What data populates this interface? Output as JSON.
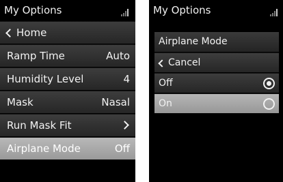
{
  "left_screen": {
    "title": "My Options",
    "items": [
      {
        "label": "Home"
      },
      {
        "label": "Ramp Time",
        "value": "Auto"
      },
      {
        "label": "Humidity Level",
        "value": "4"
      },
      {
        "label": "Mask",
        "value": "Nasal"
      },
      {
        "label": "Run Mask Fit"
      },
      {
        "label": "Airplane Mode",
        "value": "Off"
      }
    ]
  },
  "right_screen": {
    "title": "My Options",
    "header": "Airplane Mode",
    "cancel_label": "Cancel",
    "options": [
      {
        "label": "Off",
        "checked": true
      },
      {
        "label": "On",
        "checked": false
      }
    ]
  },
  "colors": {
    "background": "#000000",
    "row": "#333333",
    "selected_row": "#a8a8a8",
    "text": "#f2f2f2"
  }
}
